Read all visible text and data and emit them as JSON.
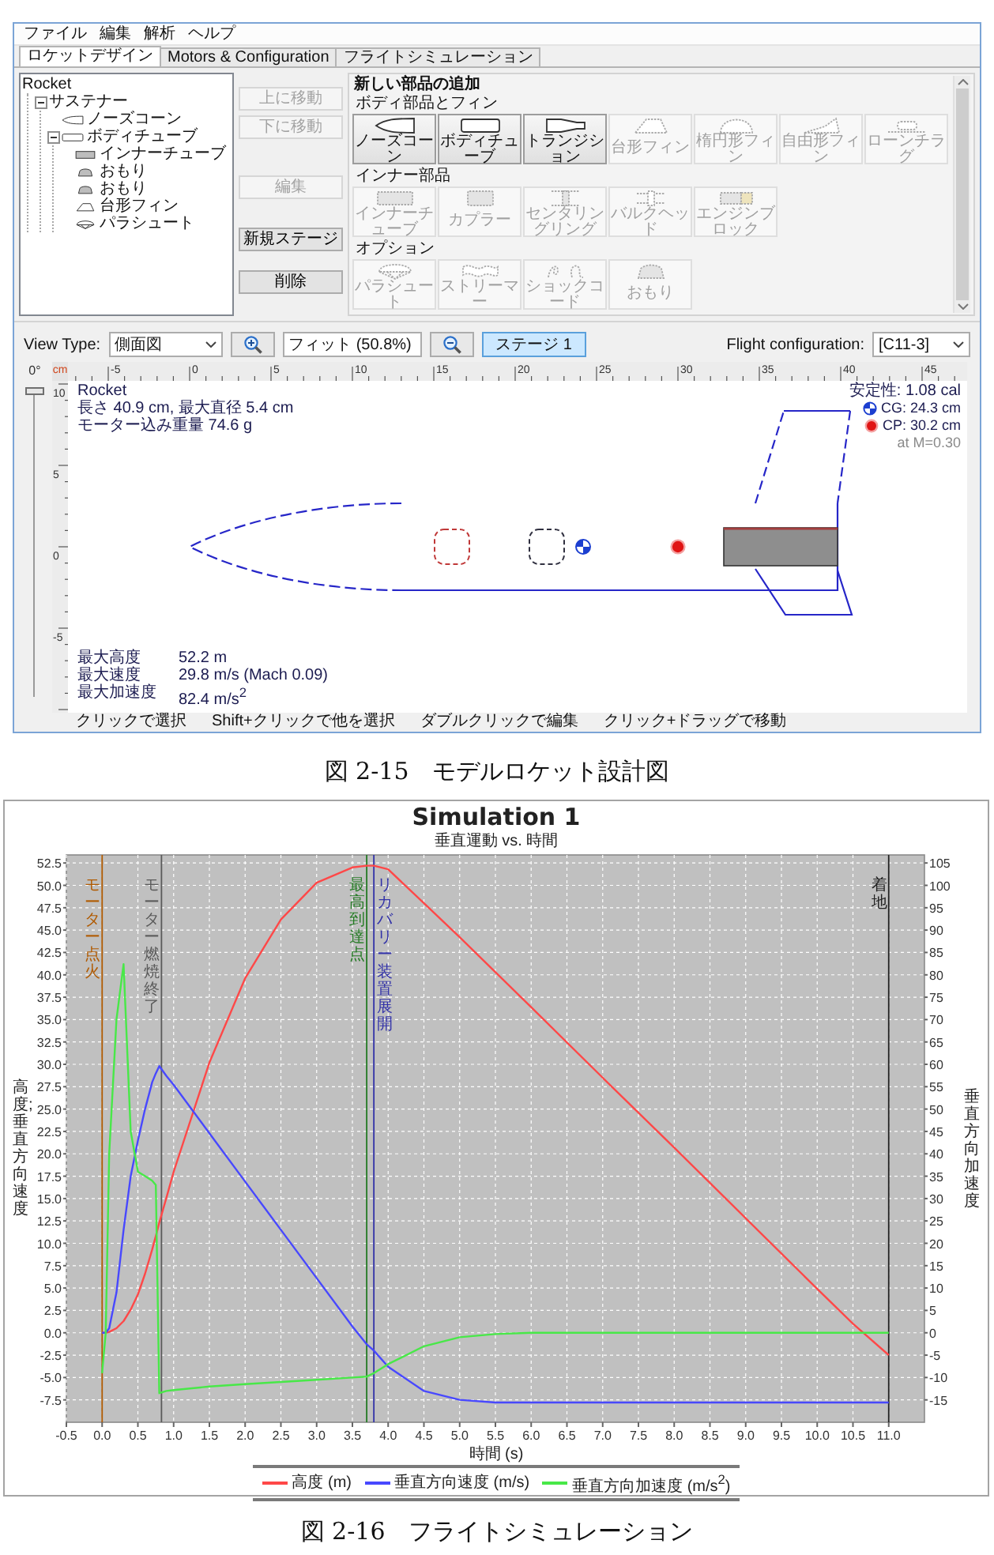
{
  "app_window": {
    "menu": [
      "ファイル",
      "編集",
      "解析",
      "ヘルプ"
    ],
    "tabs": [
      {
        "label": "ロケットデザイン",
        "selected": true
      },
      {
        "label": "Motors & Configuration",
        "selected": false
      },
      {
        "label": "フライトシミュレーション",
        "selected": false
      }
    ],
    "component_tree": [
      {
        "label": "Rocket",
        "children": [
          {
            "label": "サステナー",
            "expanded": true,
            "children": [
              {
                "label": "ノーズコーン",
                "kind": "nosecone"
              },
              {
                "label": "ボディチューブ",
                "kind": "tube",
                "expanded": true,
                "children": [
                  {
                    "label": "インナーチューブ",
                    "kind": "innertube"
                  },
                  {
                    "label": "おもり",
                    "kind": "mass"
                  },
                  {
                    "label": "おもり",
                    "kind": "mass"
                  },
                  {
                    "label": "台形フィン",
                    "kind": "trapezoid"
                  },
                  {
                    "label": "パラシュート",
                    "kind": "parachute"
                  }
                ]
              }
            ]
          }
        ]
      }
    ],
    "tree_buttons": [
      {
        "label": "上に移動",
        "disabled": true
      },
      {
        "label": "下に移動",
        "disabled": true
      },
      {
        "label": "編集",
        "disabled": true
      },
      {
        "label": "新規ステージ",
        "disabled": false
      },
      {
        "label": "削除",
        "disabled": false
      }
    ],
    "add_components": {
      "title": "新しい部品の追加",
      "sections": [
        {
          "heading": "ボディ部品とフィン",
          "items": [
            {
              "label": "ノーズコーン",
              "kind": "nosecone",
              "disabled": false
            },
            {
              "label": "ボディチューブ",
              "kind": "tube",
              "disabled": false
            },
            {
              "label": "トランジション",
              "kind": "transition",
              "disabled": false
            },
            {
              "label": "台形フィン",
              "kind": "trapezoid",
              "disabled": true
            },
            {
              "label": "楕円形フィン",
              "kind": "elliptical",
              "disabled": true
            },
            {
              "label": "自由形フィン",
              "kind": "freeform",
              "disabled": true
            },
            {
              "label": "ローンチラグ",
              "kind": "lug",
              "disabled": true
            }
          ]
        },
        {
          "heading": "インナー部品",
          "items": [
            {
              "label": "インナーチューブ",
              "kind": "innertube",
              "disabled": true
            },
            {
              "label": "カプラー",
              "kind": "coupler",
              "disabled": true
            },
            {
              "label": "センタリングリング",
              "kind": "ring",
              "disabled": true
            },
            {
              "label": "バルクヘッド",
              "kind": "bulkhead",
              "disabled": true
            },
            {
              "label": "エンジンブロック",
              "kind": "block",
              "disabled": true
            }
          ]
        },
        {
          "heading": "オプション",
          "items": [
            {
              "label": "パラシュート",
              "kind": "parachute",
              "disabled": true
            },
            {
              "label": "ストリーマー",
              "kind": "streamer",
              "disabled": true
            },
            {
              "label": "ショックコード",
              "kind": "cord",
              "disabled": true
            },
            {
              "label": "おもり",
              "kind": "mass",
              "disabled": true
            }
          ]
        }
      ]
    },
    "toolbar": {
      "view_type_label": "View Type:",
      "view_type": "側面図",
      "zoom": "フィット (50.8%)",
      "stage_button": {
        "label": "ステージ 1",
        "selected": true
      },
      "flight_configuration_label": "Flight configuration:",
      "flight_configuration": "[C11-3]"
    },
    "design_view": {
      "rotation_label": "0°",
      "rotation_slider": {
        "level": 0
      },
      "ruler_unit": "cm",
      "top_ruler": [
        "-5",
        "0",
        "5",
        "10",
        "15",
        "20",
        "25",
        "30",
        "35",
        "40",
        "45"
      ],
      "side_ruler": [
        "10",
        "5",
        "0",
        "-5"
      ],
      "rocket_info": [
        "Rocket",
        "長さ 40.9 cm, 最大直径 5.4 cm",
        "モーター込み重量 74.6 g"
      ],
      "stability": [
        {
          "text": "安定性: 1.08 cal",
          "kind": "text"
        },
        {
          "text": "CG: 24.3 cm",
          "kind": "cg"
        },
        {
          "text": "CP: 30.2 cm",
          "kind": "cp"
        },
        {
          "text": "at M=0.30",
          "kind": "note"
        }
      ],
      "flight_stats": [
        {
          "label": "最大高度",
          "value": "52.2 m"
        },
        {
          "label": "最大速度",
          "value": "29.8 m/s (Mach 0.09)"
        },
        {
          "label": "最大加速度",
          "value": "82.4 m/s$^{2}$"
        }
      ]
    },
    "hints": [
      "クリックで選択",
      "Shift+クリックで他を選択",
      "ダブルクリックで編集",
      "クリック+ドラッグで移動"
    ]
  },
  "figure_1_caption": "図 2-15　モデルロケット設計図",
  "chart": {
    "chart_data": {
      "type": "line",
      "title": "Simulation 1",
      "subtitle": "垂直運動 vs. 時間",
      "xlabel": "時間 (s)",
      "ylabel": "高度; 垂直方向速度",
      "y2label": "垂直方向加速度",
      "grid": true,
      "x": [
        0,
        0.05,
        0.1,
        0.2,
        0.3,
        0.4,
        0.5,
        0.6,
        0.7,
        0.75,
        0.8,
        0.9,
        1.0,
        1.5,
        2.0,
        2.5,
        3.0,
        3.5,
        3.7,
        3.8,
        4.0,
        4.5,
        5.0,
        5.5,
        6.0,
        7.0,
        8.0,
        9.0,
        10.0,
        10.5,
        11.0
      ],
      "series": [
        {
          "name": "高度 (m)",
          "color": "#ff4848",
          "values": [
            0,
            0,
            0.1,
            0.5,
            1.3,
            2.6,
            4.3,
            6.6,
            9.3,
            10.8,
            12.3,
            15.1,
            18.0,
            30.2,
            39.6,
            46.2,
            50.3,
            52.0,
            52.2,
            52.2,
            51.8,
            48.0,
            44.2,
            40.3,
            36.4,
            28.5,
            20.7,
            12.8,
            4.9,
            1.0,
            -2.5
          ]
        },
        {
          "name": "垂直方向速度 (m/s)",
          "color": "#4848ff",
          "values": [
            0,
            0,
            0.5,
            4.5,
            11.5,
            17.5,
            21.5,
            25.0,
            28.0,
            29.0,
            29.8,
            28.7,
            27.7,
            22.3,
            16.9,
            11.5,
            6.1,
            0.7,
            -1.3,
            -2.0,
            -3.8,
            -6.5,
            -7.5,
            -7.8,
            -7.8,
            -7.8,
            -7.8,
            -7.8,
            -7.8,
            -7.8,
            -7.8
          ]
        },
        {
          "name": "垂直方向加速度 (m/s$^{2}$)",
          "color": "#48e848",
          "axis": "y2",
          "values": [
            -9,
            0,
            40,
            70,
            82.4,
            45,
            36,
            35,
            34,
            33,
            -13.5,
            -13,
            -12.8,
            -12,
            -11.5,
            -11,
            -10.5,
            -10,
            -9.8,
            -9,
            -7,
            -3,
            -1,
            -0.3,
            0,
            0,
            0,
            0,
            0,
            0,
            0
          ]
        }
      ],
      "xlim": [
        -0.5,
        11.5
      ],
      "ylim": [
        -10,
        53.4
      ],
      "y2lim": [
        -20,
        106.8
      ],
      "xticks": [
        -0.5,
        {
          "value": 0,
          "label": "0.0"
        },
        0.5,
        {
          "value": 1,
          "label": "1.0"
        },
        1.5,
        {
          "value": 2,
          "label": "2.0"
        },
        2.5,
        {
          "value": 3,
          "label": "3.0"
        },
        3.5,
        {
          "value": 4,
          "label": "4.0"
        },
        4.5,
        {
          "value": 5,
          "label": "5.0"
        },
        5.5,
        {
          "value": 6,
          "label": "6.0"
        },
        6.5,
        {
          "value": 7,
          "label": "7.0"
        },
        7.5,
        {
          "value": 8,
          "label": "8.0"
        },
        8.5,
        {
          "value": 9,
          "label": "9.0"
        },
        9.5,
        {
          "value": 10,
          "label": "10.0"
        },
        10.5,
        {
          "value": 11,
          "label": "11.0"
        }
      ],
      "yticks": [
        -7.5,
        {
          "value": -5,
          "label": "-5.0"
        },
        -2.5,
        {
          "value": 0,
          "label": "0.0"
        },
        2.5,
        {
          "value": 5,
          "label": "5.0"
        },
        7.5,
        {
          "value": 10,
          "label": "10.0"
        },
        12.5,
        {
          "value": 15,
          "label": "15.0"
        },
        17.5,
        {
          "value": 20,
          "label": "20.0"
        },
        22.5,
        {
          "value": 25,
          "label": "25.0"
        },
        27.5,
        {
          "value": 30,
          "label": "30.0"
        },
        32.5,
        {
          "value": 35,
          "label": "35.0"
        },
        37.5,
        {
          "value": 40,
          "label": "40.0"
        },
        42.5,
        {
          "value": 45,
          "label": "45.0"
        },
        47.5,
        {
          "value": 50,
          "label": "50.0"
        },
        52.5
      ],
      "y2ticks": [
        -15,
        -10,
        -5,
        0,
        5,
        10,
        15,
        20,
        25,
        30,
        35,
        40,
        45,
        50,
        55,
        60,
        65,
        70,
        75,
        80,
        85,
        90,
        95,
        100,
        105
      ],
      "ref_lines": [
        {
          "axis": "x",
          "value": 0,
          "label": "モーター点火",
          "color": "#b05a00"
        },
        {
          "axis": "x",
          "value": 0.83,
          "label": "モーター燃焼終了",
          "color": "#5a5a5a"
        },
        {
          "axis": "x",
          "value": 3.7,
          "label": "最高到達点",
          "color": "#237a23"
        },
        {
          "axis": "x",
          "value": 3.8,
          "label": "リカバリー装置展開",
          "color": "#3232a8"
        },
        {
          "axis": "x",
          "value": 11.0,
          "label": "着地",
          "color": "#222222"
        }
      ]
    }
  },
  "figure_2_caption": "図 2-16　フライトシミュレーション"
}
